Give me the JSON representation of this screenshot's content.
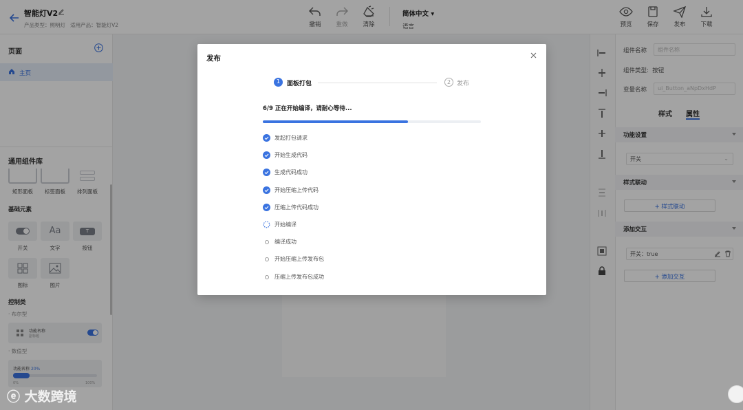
{
  "header": {
    "title": "智能灯V2",
    "product_type": "产品类型：照明灯",
    "applicable": "适用产品：智能灯V2",
    "tools": {
      "undo": "撤销",
      "redo": "重做",
      "clear": "清除"
    },
    "language_value": "简体中文",
    "language_label": "语言",
    "actions": {
      "preview": "预览",
      "save": "保存",
      "publish": "发布",
      "download": "下载"
    }
  },
  "left": {
    "pages_title": "页面",
    "page_item": "主页",
    "library_title": "通用组件库",
    "panels": [
      "矩形面板",
      "标签面板",
      "排列面板"
    ],
    "basic_title": "基础元素",
    "basic": [
      "开关",
      "文字",
      "按钮",
      "图标",
      "图片"
    ],
    "text_glyph": "Aa",
    "button_glyph": "T",
    "control_title": "控制类",
    "cloth_type": "布尔型",
    "control_card_name": "功能名称",
    "control_card_sub": "副标题",
    "numeric_type": "数值型",
    "slider_name": "功能名称",
    "slider_pct": "20%",
    "slider_min": "0%",
    "slider_max": "100%"
  },
  "right": {
    "comp_name_label": "组件名称",
    "comp_name_placeholder": "组件名称",
    "comp_type_label": "组件类型:",
    "comp_type_value": "按钮",
    "var_name_label": "变量名称",
    "var_name_value": "ui_Button_aNpDxHdP",
    "tab_style": "样式",
    "tab_attr": "属性",
    "func_settings": "功能设置",
    "func_select": "开关",
    "style_link": "样式联动",
    "style_link_btn": "+ 样式联动",
    "add_interact": "添加交互",
    "interact_item": "开关：true",
    "add_interact_btn": "+ 添加交互"
  },
  "modal": {
    "title": "发布",
    "step1_num": "1",
    "step1_label": "面板打包",
    "step2_num": "2",
    "step2_label": "发布",
    "progress_text": "6/9  正在开始编译，请耐心等待...",
    "progress_fraction": 0.667,
    "steps": [
      {
        "label": "发起打包请求",
        "status": "done"
      },
      {
        "label": "开始生成代码",
        "status": "done"
      },
      {
        "label": "生成代码成功",
        "status": "done"
      },
      {
        "label": "开始压缩上传代码",
        "status": "done"
      },
      {
        "label": "压缩上传代码成功",
        "status": "done"
      },
      {
        "label": "开始编译",
        "status": "loading"
      },
      {
        "label": "编译成功",
        "status": "pending"
      },
      {
        "label": "开始压缩上传发布包",
        "status": "pending"
      },
      {
        "label": "压缩上传发布包成功",
        "status": "pending"
      }
    ]
  },
  "watermark": "大数跨境",
  "colors": {
    "accent": "#3a73e0",
    "overlay": "rgba(0,0,0,0.36)"
  }
}
